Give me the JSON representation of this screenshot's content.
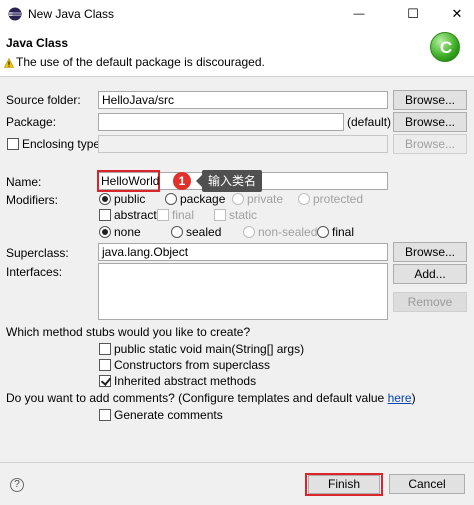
{
  "window": {
    "title": "New Java Class",
    "minimize_glyph": "—",
    "maximize_glyph": "☐",
    "close_glyph": "✕"
  },
  "header": {
    "title": "Java Class",
    "message": "The use of the default package is discouraged.",
    "logo_letter": "C"
  },
  "source_folder": {
    "label": "Source folder:",
    "value": "HelloJava/src",
    "browse_label": "Browse..."
  },
  "package": {
    "label": "Package:",
    "value": "",
    "default_label": "(default)",
    "browse_label": "Browse..."
  },
  "enclosing_type": {
    "label": "Enclosing type:",
    "value": "",
    "checked": false,
    "browse_label": "Browse..."
  },
  "name": {
    "label": "Name:",
    "value": "HelloWorld",
    "badge": "1",
    "tooltip": "输入类名"
  },
  "modifiers": {
    "label": "Modifiers:",
    "access": [
      "public",
      "package",
      "private",
      "protected"
    ],
    "abstract_label": "abstract",
    "final_label": "final",
    "static_label": "static",
    "sealing": [
      "none",
      "sealed",
      "non-sealed",
      "final"
    ]
  },
  "superclass": {
    "label": "Superclass:",
    "value": "java.lang.Object",
    "browse_label": "Browse..."
  },
  "interfaces": {
    "label": "Interfaces:",
    "add_label": "Add...",
    "remove_label": "Remove"
  },
  "stubs": {
    "question": "Which method stubs would you like to create?",
    "main_label": "public static void main(String[] args)",
    "constructors_label": "Constructors from superclass",
    "inherited_label": "Inherited abstract methods"
  },
  "comments": {
    "question": "Do you want to add comments? (Configure templates and default value ",
    "link_text": "here",
    "close_paren": ")",
    "generate_label": "Generate comments"
  },
  "footer": {
    "help_glyph": "?",
    "finish_label": "Finish",
    "cancel_label": "Cancel"
  },
  "colors": {
    "highlight": "#d9262c",
    "tooltip_bg": "#505050",
    "logo_green": "#37a81f"
  }
}
